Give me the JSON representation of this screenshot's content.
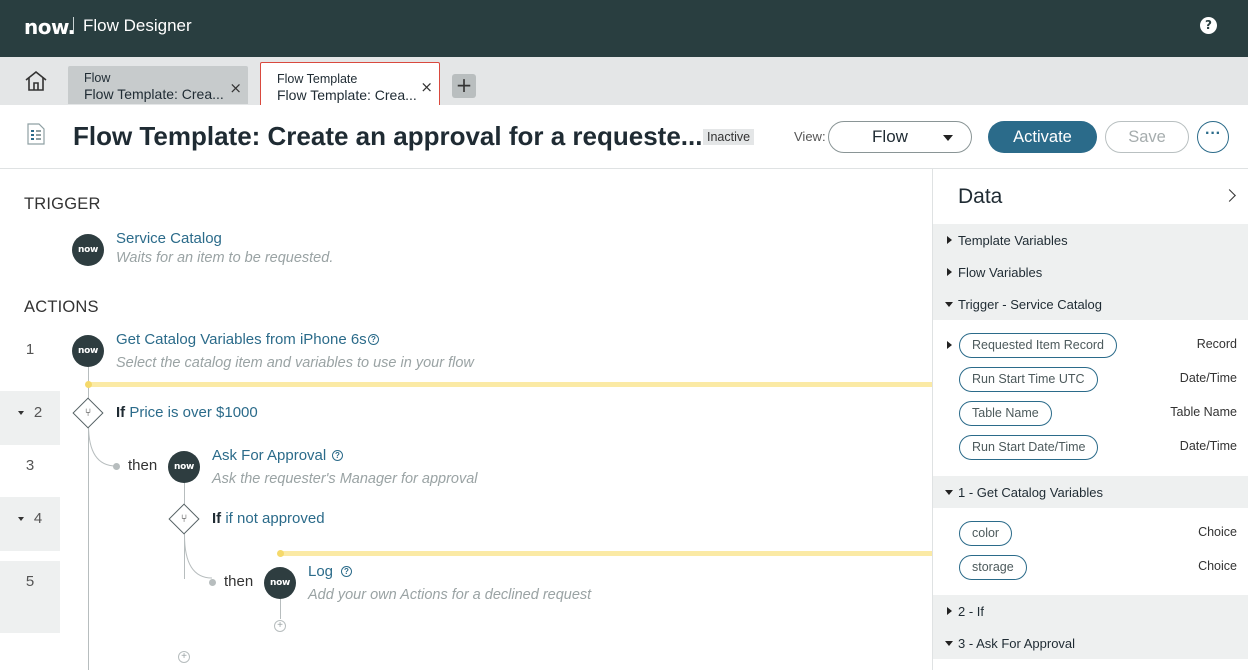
{
  "topbar": {
    "logo": "now.",
    "title": "Flow Designer",
    "help": "?"
  },
  "tabs": [
    {
      "type": "Flow",
      "name": "Flow Template: Crea...",
      "close": "×"
    },
    {
      "type": "Flow Template",
      "name": "Flow Template: Crea...",
      "close": "×"
    }
  ],
  "add_tab": "+",
  "header": {
    "title": "Flow Template: Create an approval for a requeste...",
    "status": "Inactive",
    "view_label": "View:",
    "view_value": "Flow",
    "activate": "Activate",
    "save": "Save",
    "more": "···"
  },
  "canvas": {
    "trigger_label": "TRIGGER",
    "trigger": {
      "icon": "now",
      "title": "Service Catalog",
      "desc": "Waits for an item to be requested."
    },
    "actions_label": "ACTIONS",
    "steps": [
      {
        "num": "1",
        "icon": "now",
        "title": "Get Catalog Variables from iPhone 6s",
        "desc": "Select the catalog item and variables to use in your flow"
      },
      {
        "num": "2",
        "if_kw": "If",
        "if_cond": "Price is over $1000"
      },
      {
        "num": "3",
        "then": "then",
        "icon": "now",
        "title": "Ask For Approval",
        "desc": "Ask the requester's Manager for approval"
      },
      {
        "num": "4",
        "if_kw": "If",
        "if_cond": "if not approved"
      },
      {
        "num": "5",
        "then": "then",
        "icon": "now",
        "title": "Log",
        "desc": "Add your own Actions for a declined request"
      }
    ]
  },
  "panel": {
    "title": "Data",
    "sections": [
      {
        "label": "Template Variables"
      },
      {
        "label": "Flow Variables"
      },
      {
        "label": "Trigger - Service Catalog"
      },
      {
        "label": "1 - Get Catalog Variables"
      },
      {
        "label": "2 - If"
      },
      {
        "label": "3 - Ask For Approval"
      }
    ],
    "trigger_fields": [
      {
        "name": "Requested Item Record",
        "type": "Record"
      },
      {
        "name": "Run Start Time UTC",
        "type": "Date/Time"
      },
      {
        "name": "Table Name",
        "type": "Table Name"
      },
      {
        "name": "Run Start Date/Time",
        "type": "Date/Time"
      }
    ],
    "catalog_fields": [
      {
        "name": "color",
        "type": "Choice"
      },
      {
        "name": "storage",
        "type": "Choice"
      }
    ]
  }
}
